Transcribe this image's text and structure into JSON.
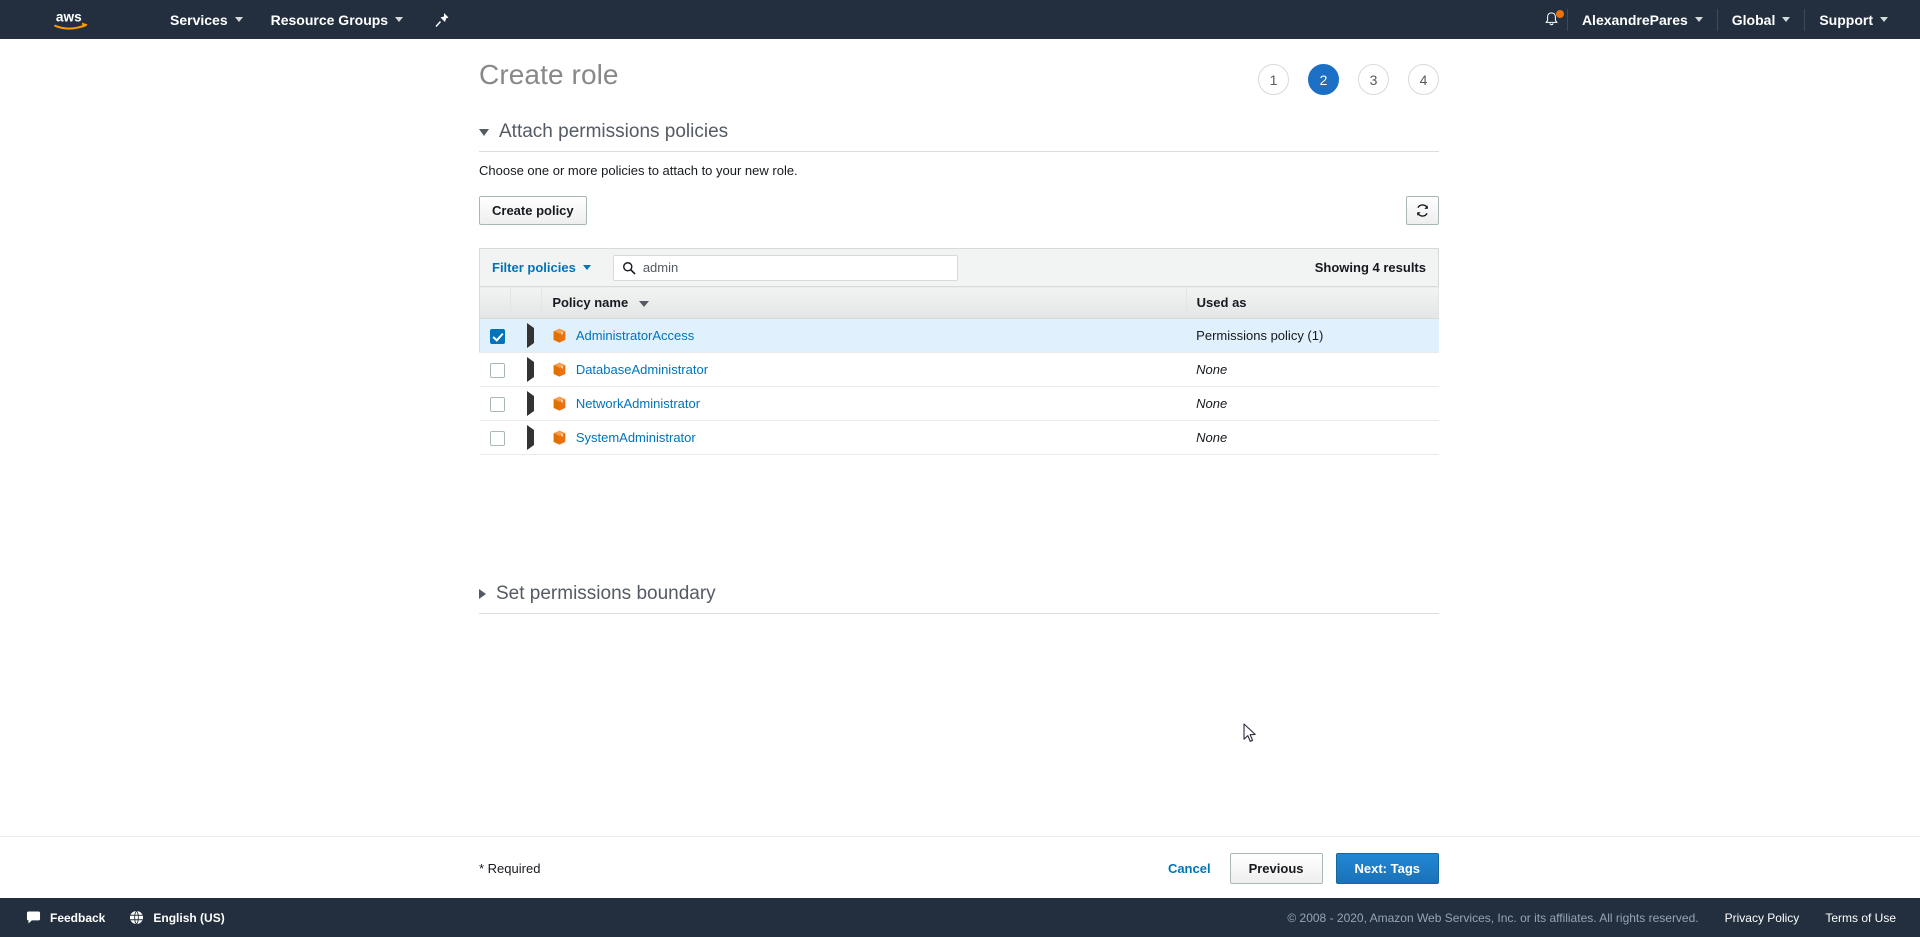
{
  "nav": {
    "logo_alt": "aws-logo",
    "services_label": "Services",
    "resource_groups_label": "Resource Groups",
    "pin_icon": "pin-icon",
    "bell_icon": "bell-icon",
    "account_label": "AlexandrePares",
    "region_label": "Global",
    "support_label": "Support"
  },
  "page": {
    "title": "Create role",
    "steps": [
      "1",
      "2",
      "3",
      "4"
    ],
    "active_step": "2"
  },
  "permissions_section": {
    "title": "Attach permissions policies",
    "description": "Choose one or more policies to attach to your new role.",
    "create_policy_label": "Create policy",
    "refresh_icon": "refresh-icon"
  },
  "filter": {
    "filter_label": "Filter policies",
    "search_icon": "search-icon",
    "search_value": "admin",
    "search_placeholder": "Search",
    "results_text": "Showing 4 results"
  },
  "table": {
    "columns": {
      "select": "",
      "expand": "",
      "policy_name": "Policy name",
      "used_as": "Used as"
    },
    "sort_column": "Policy name",
    "rows": [
      {
        "checked": true,
        "name": "AdministratorAccess",
        "used_as": "Permissions policy (1)",
        "used_as_none": false,
        "icon": "policy-cube-icon"
      },
      {
        "checked": false,
        "name": "DatabaseAdministrator",
        "used_as": "None",
        "used_as_none": true,
        "icon": "policy-cube-icon"
      },
      {
        "checked": false,
        "name": "NetworkAdministrator",
        "used_as": "None",
        "used_as_none": true,
        "icon": "policy-cube-icon"
      },
      {
        "checked": false,
        "name": "SystemAdministrator",
        "used_as": "None",
        "used_as_none": true,
        "icon": "policy-cube-icon"
      }
    ]
  },
  "boundary_section": {
    "title": "Set permissions boundary"
  },
  "actions": {
    "required_text": "* Required",
    "cancel_label": "Cancel",
    "previous_label": "Previous",
    "next_label": "Next: Tags"
  },
  "footer": {
    "feedback_label": "Feedback",
    "language_label": "English (US)",
    "copyright": "© 2008 - 2020, Amazon Web Services, Inc. or its affiliates. All rights reserved.",
    "privacy_label": "Privacy Policy",
    "terms_label": "Terms of Use"
  },
  "colors": {
    "nav_bg": "#232f3e",
    "accent_blue": "#0073bb",
    "active_step": "#1b6fc4",
    "selected_row": "#e1f0fd",
    "policy_icon": "#ec7211"
  }
}
